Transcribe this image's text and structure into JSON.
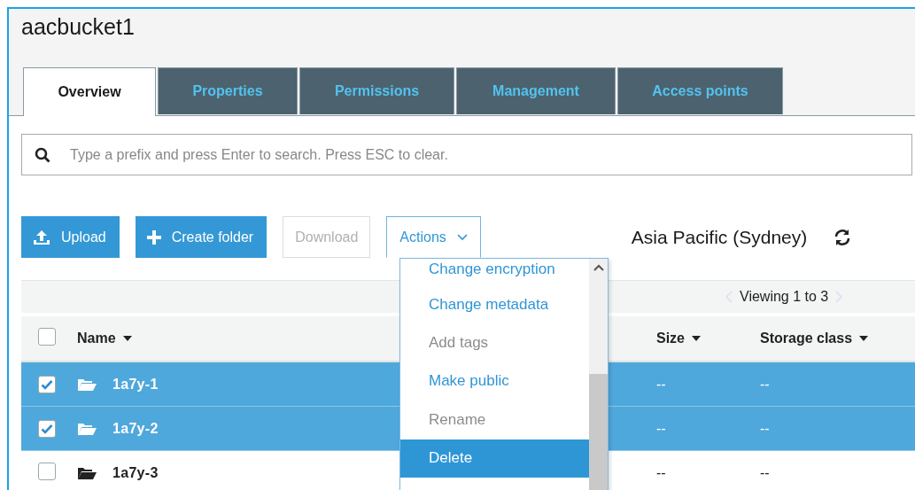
{
  "bucket": {
    "title": "aacbucket1"
  },
  "tabs": [
    {
      "label": "Overview",
      "selected": true
    },
    {
      "label": "Properties",
      "selected": false
    },
    {
      "label": "Permissions",
      "selected": false
    },
    {
      "label": "Management",
      "selected": false
    },
    {
      "label": "Access points",
      "selected": false
    }
  ],
  "search": {
    "placeholder": "Type a prefix and press Enter to search. Press ESC to clear."
  },
  "toolbar": {
    "buttons": [
      {
        "label": "Upload",
        "kind": "upload",
        "disabled": false
      },
      {
        "label": "Create folder",
        "kind": "create",
        "disabled": false
      },
      {
        "label": "Download",
        "kind": "plain",
        "disabled": true
      },
      {
        "label": "Actions",
        "kind": "dropdown",
        "disabled": false,
        "expanded": true
      }
    ],
    "region": "Asia Pacific (Sydney)"
  },
  "actions_menu": {
    "items": [
      {
        "label": "Change encryption",
        "disabled": false,
        "selected": false
      },
      {
        "label": "Change metadata",
        "disabled": false,
        "selected": false
      },
      {
        "label": "Add tags",
        "disabled": true,
        "selected": false
      },
      {
        "label": "Make public",
        "disabled": false,
        "selected": false
      },
      {
        "label": "Rename",
        "disabled": true,
        "selected": false
      },
      {
        "label": "Delete",
        "disabled": false,
        "selected": true
      }
    ]
  },
  "table": {
    "pagination": "Viewing 1 to 3",
    "select_all": {
      "checked": false
    },
    "columns": [
      "Name",
      "Size",
      "Storage class"
    ],
    "rows": [
      {
        "name": "1a7y-1",
        "size": "--",
        "storage_class": "--",
        "checked": true,
        "selected": true
      },
      {
        "name": "1a7y-2",
        "size": "--",
        "storage_class": "--",
        "checked": true,
        "selected": true
      },
      {
        "name": "1a7y-3",
        "size": "--",
        "storage_class": "--",
        "checked": false,
        "selected": false
      }
    ]
  }
}
